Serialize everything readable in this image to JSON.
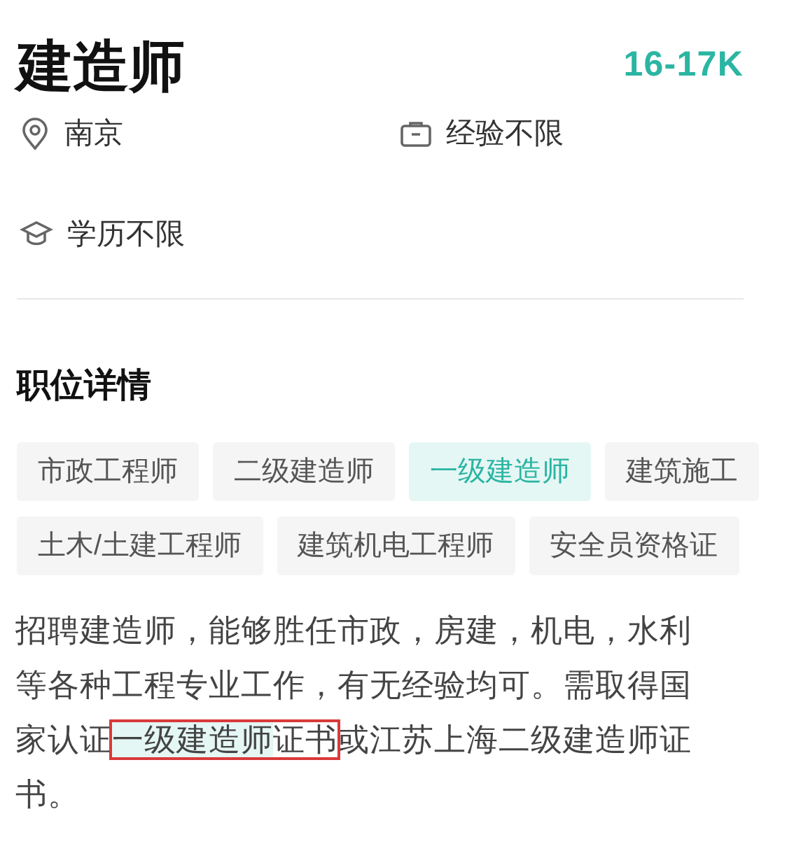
{
  "job": {
    "title": "建造师",
    "salary": "16-17K"
  },
  "info": [
    {
      "kind": "location",
      "text": "南京"
    },
    {
      "kind": "experience",
      "text": "经验不限"
    },
    {
      "kind": "education",
      "text": "学历不限"
    }
  ],
  "section_title": "职位详情",
  "tags": [
    {
      "label": "市政工程师",
      "selected": false
    },
    {
      "label": "二级建造师",
      "selected": false
    },
    {
      "label": "一级建造师",
      "selected": true
    },
    {
      "label": "建筑施工",
      "selected": false
    },
    {
      "label": "土木/土建工程师",
      "selected": false
    },
    {
      "label": "建筑机电工程师",
      "selected": false
    },
    {
      "label": "安全员资格证",
      "selected": false
    }
  ],
  "description": {
    "before": "招聘建造师，能够胜任市政，房建，机电，水利等各种工程专业工作，有无经验均可。需取得国家认证",
    "boxed": [
      {
        "text": "一级建造师",
        "highlight": true
      },
      {
        "text": "证书",
        "highlight": false
      }
    ],
    "after": "或江苏上海二级建造师证书。"
  }
}
